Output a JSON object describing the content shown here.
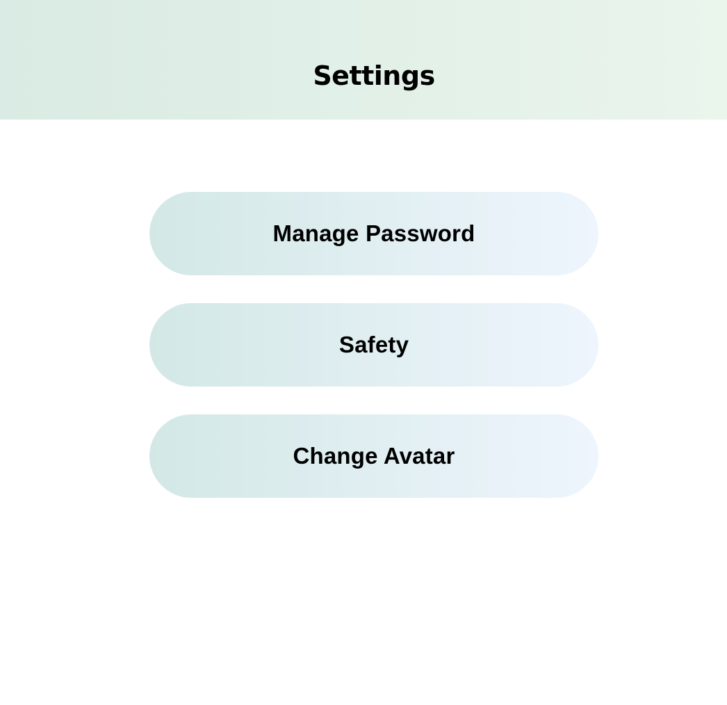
{
  "header": {
    "title": "Settings"
  },
  "menu": {
    "items": [
      {
        "label": "Manage Password"
      },
      {
        "label": "Safety"
      },
      {
        "label": "Change Avatar"
      }
    ]
  },
  "colors": {
    "header_gradient_start": "#d9ebe4",
    "header_gradient_end": "#eaf5ec",
    "button_gradient_start": "#d3e8e6",
    "button_gradient_end": "#eef5fd",
    "text": "#000000"
  }
}
